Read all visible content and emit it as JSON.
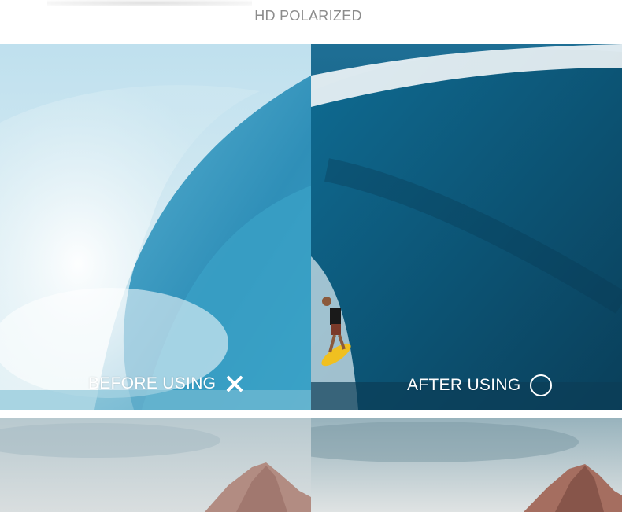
{
  "header": {
    "title": "HD POLARIZED"
  },
  "comparison": {
    "before_label": "BEFORE USING",
    "after_label": "AFTER USING",
    "before_icon": "cross-icon",
    "after_icon": "circle-icon"
  },
  "colors": {
    "header_text": "#8c8c8c",
    "label_text": "#ffffff",
    "before_wave": "#3f9bc0",
    "after_wave": "#1d5f84",
    "before_sky": "#cfe5ee",
    "after_sky": "#2d7ea5"
  }
}
